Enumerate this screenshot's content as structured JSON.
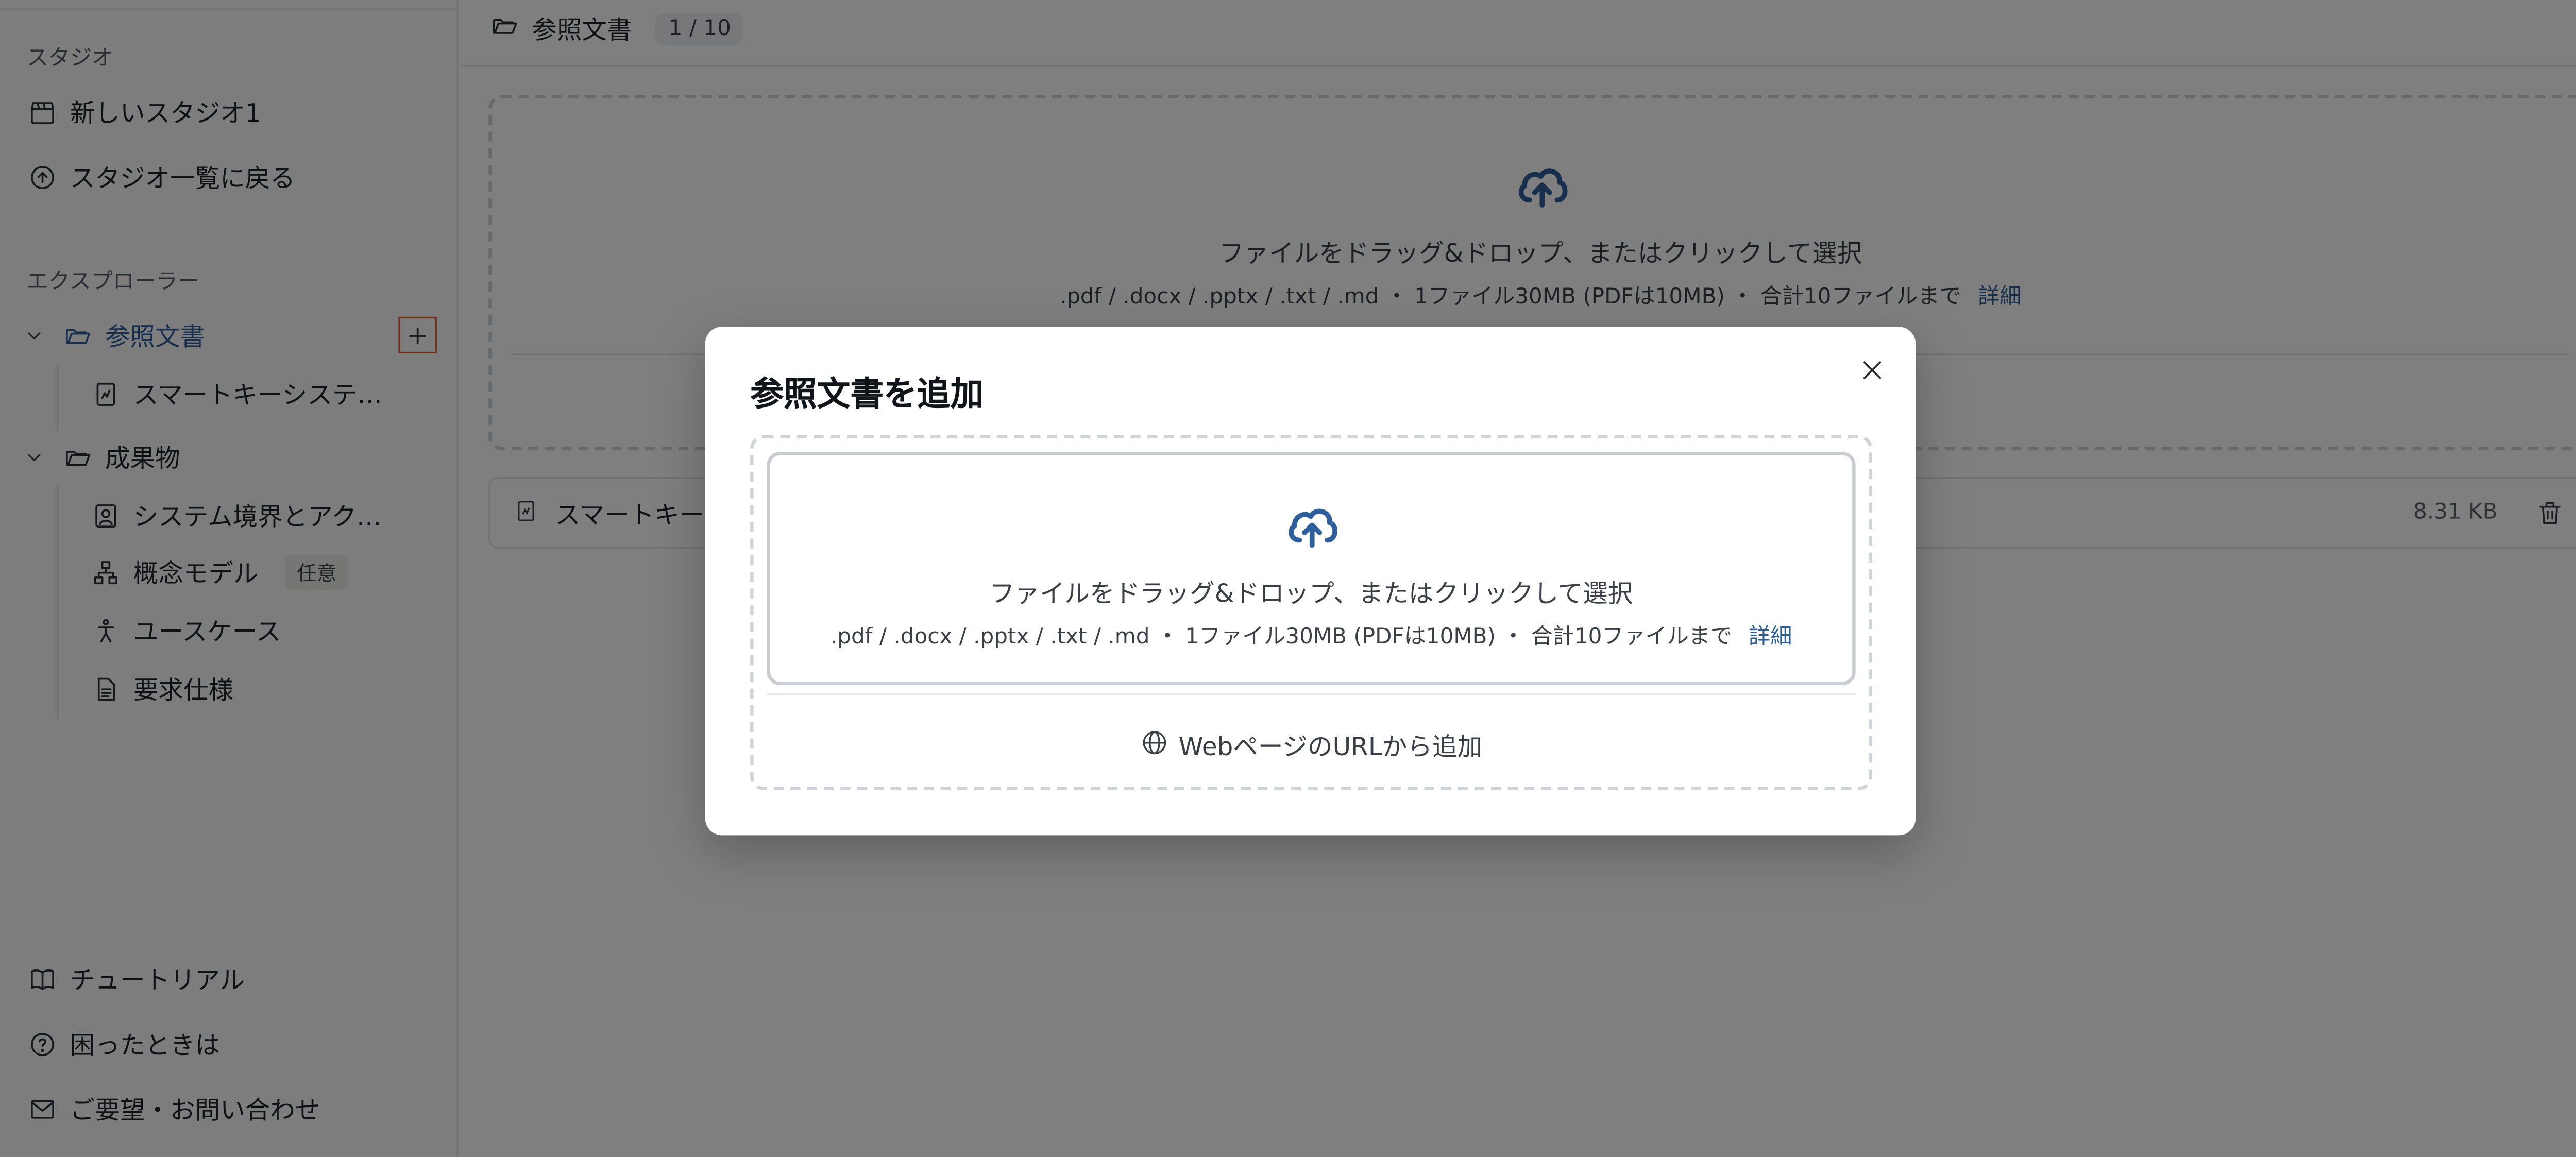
{
  "sidebar": {
    "studio_section_label": "スタジオ",
    "studio_name": "新しいスタジオ1",
    "back_to_list": "スタジオ一覧に戻る",
    "explorer_label": "エクスプローラー",
    "reference_folder": "参照文書",
    "reference_file": "スマートキーシステ…",
    "deliverables_folder": "成果物",
    "deliverables": [
      {
        "label": "システム境界とアク…",
        "icon": "portrait-icon"
      },
      {
        "label": "概念モデル",
        "icon": "hierarchy-icon",
        "badge": "任意"
      },
      {
        "label": "ユースケース",
        "icon": "person-icon"
      },
      {
        "label": "要求仕様",
        "icon": "document-icon"
      }
    ],
    "tutorial": "チュートリアル",
    "help": "困ったときは",
    "contact": "ご要望・お問い合わせ"
  },
  "main": {
    "folder_title": "参照文書",
    "file_count": "1 / 10",
    "drop_text": "ファイルをドラッグ&ドロップ、またはクリックして選択",
    "drop_hint": ".pdf / .docx / .pptx / .txt / .md ・ 1ファイル30MB (PDFは10MB) ・ 合計10ファイルまで",
    "details_link": "詳細",
    "file_name": "スマートキー",
    "file_size": "8.31 KB"
  },
  "modal": {
    "title": "参照文書を追加",
    "drop_text": "ファイルをドラッグ&ドロップ、またはクリックして選択",
    "drop_hint": ".pdf / .docx / .pptx / .txt / .md ・ 1ファイル30MB (PDFは10MB) ・ 合計10ファイルまで",
    "details_link": "詳細",
    "url_add": "WebページのURLから追加"
  },
  "colors": {
    "accent": "#2e5f9a",
    "highlight_border": "#e4572e",
    "overlay": "rgba(0,0,0,0.5)"
  }
}
